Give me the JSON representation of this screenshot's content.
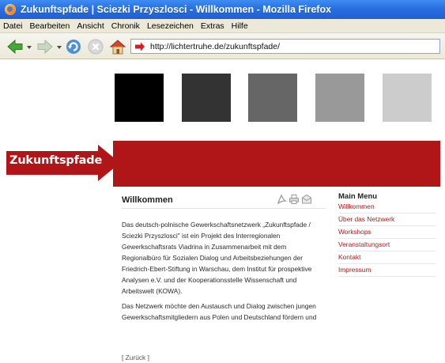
{
  "window": {
    "title": "Zukunftspfade | Sciezki Przyszlosci - Willkommen - Mozilla Firefox"
  },
  "menubar": {
    "items": [
      "Datei",
      "Bearbeiten",
      "Ansicht",
      "Chronik",
      "Lesezeichen",
      "Extras",
      "Hilfe"
    ]
  },
  "toolbar": {
    "url": "http://lichtertruhe.de/zukunftspfade/",
    "icons": [
      "back-arrow-icon",
      "forward-arrow-icon",
      "reload-icon",
      "stop-icon",
      "home-icon",
      "page-arrow-icon"
    ]
  },
  "header": {
    "logo_text": "Zukunftspfade",
    "block_colors": [
      "#000000",
      "#333333",
      "#666666",
      "#999999",
      "#cccccc"
    ],
    "band_color": "#b01617"
  },
  "article": {
    "title": "Willkommen",
    "tools": [
      "pdf-icon",
      "print-icon",
      "email-icon"
    ],
    "paragraphs": [
      "Das deutsch-polnische Gewerkschaftsnetzwerk „Zukunftspfade / Sciezki Przyszlosci\" ist ein Projekt des Interregionalen Gewerkschaftsrats Viadrina in Zusammenarbeit mit dem Regionalbüro für Sozialen Dialog und Arbeitsbeziehungen der Friedrich-Ebert-Stiftung in Warschau, dem Institut für prospektive Analysen e.V. und der Kooperationsstelle Wissenschaft und Arbeitswelt (KOWA).",
      "Das Netzwerk möchte den Austausch und Dialog zwischen jungen Gewerkschaftsmitgliedern aus Polen und Deutschland fördern und"
    ],
    "back_link": "[ Zurück ]"
  },
  "sidebar": {
    "heading": "Main Menu",
    "items": [
      "Willkommen",
      "Über das Netzwerk",
      "Workshops",
      "Veranstaltungsort",
      "Kontakt",
      "Impressum"
    ],
    "link_color": "#b51a1a"
  }
}
